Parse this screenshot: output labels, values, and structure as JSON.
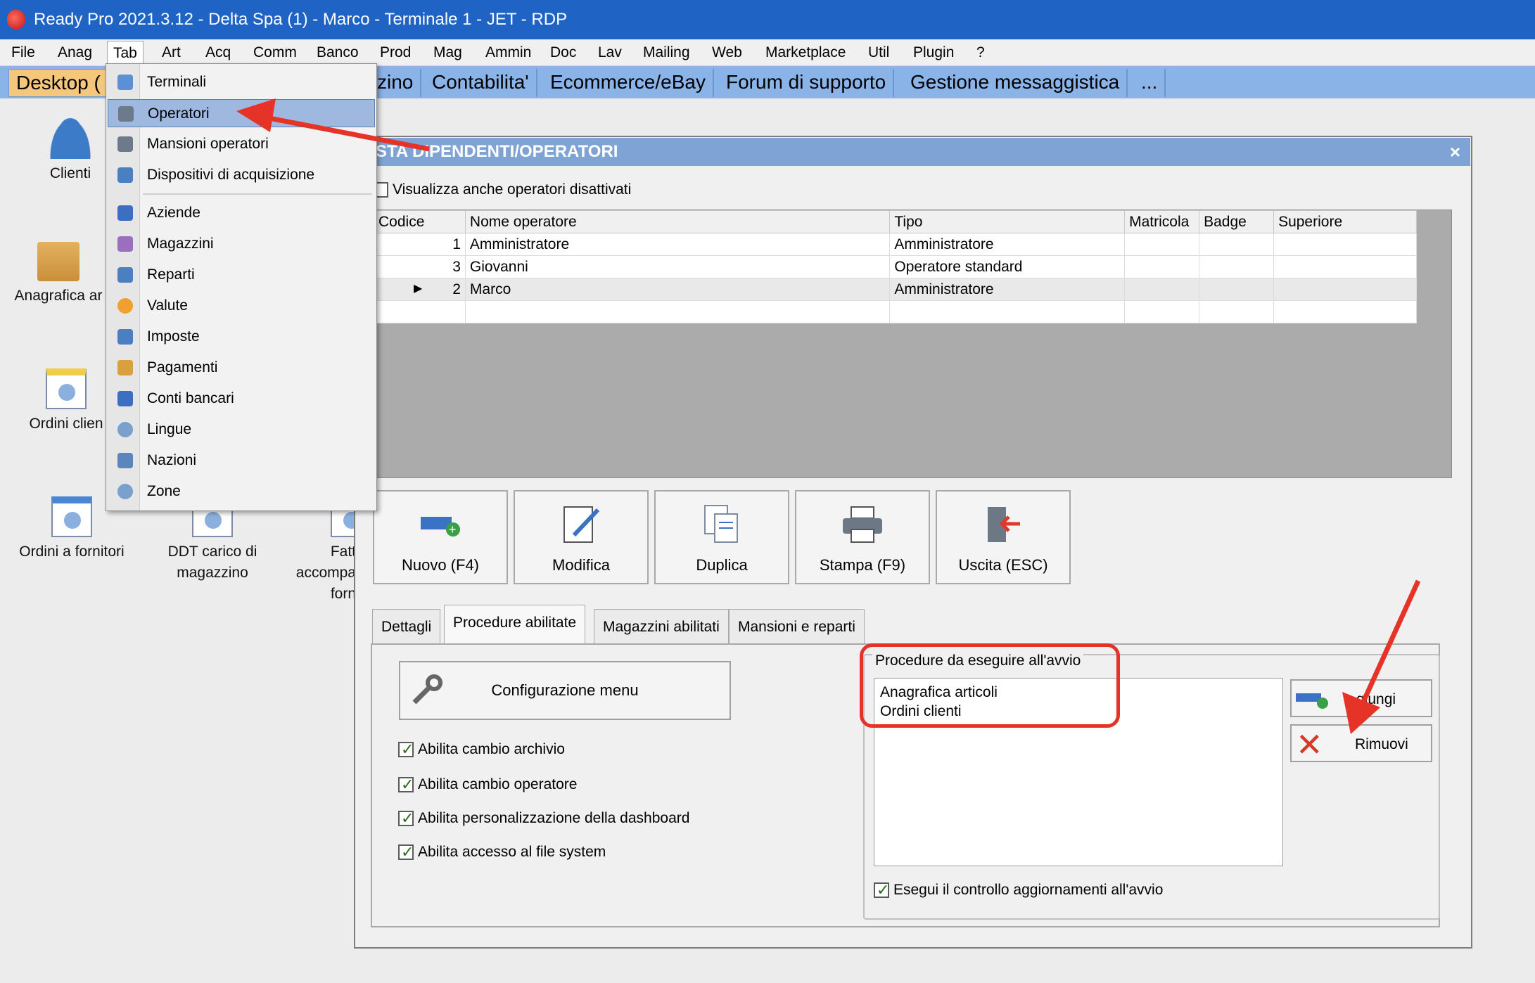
{
  "titlebar": {
    "title": "Ready Pro 2021.3.12 - Delta Spa (1) - Marco - Terminale 1 - JET - RDP"
  },
  "menubar": {
    "items": [
      "File",
      "Anag",
      "Tab",
      "Art",
      "Acq",
      "Comm",
      "Banco",
      "Prod",
      "Mag",
      "Ammin",
      "Doc",
      "Lav",
      "Mailing",
      "Web",
      "Marketplace",
      "Util",
      "Plugin",
      "?"
    ]
  },
  "tabs": {
    "items": [
      "Desktop (",
      "zino",
      "Contabilita'",
      "Ecommerce/eBay",
      "Forum di supporto",
      "Gestione messaggistica",
      "..."
    ]
  },
  "desktop": {
    "icons": [
      {
        "label": "Clienti",
        "icon": "clients-icon"
      },
      {
        "label": "Anagrafica ar",
        "icon": "box-icon"
      },
      {
        "label": "Ordini clien",
        "icon": "orders-icon"
      },
      {
        "label": "Ordini a fornitori",
        "icon": "supplier-orders-icon"
      },
      {
        "label": "DDT carico di",
        "label2": "magazzino",
        "icon": "ddt-icon"
      },
      {
        "label": "Fatt",
        "label2": "accompa",
        "label3": "forn",
        "icon": "invoice-icon"
      }
    ]
  },
  "dropdown": {
    "items": [
      {
        "label": "Terminali",
        "icon": "terminal-icon",
        "color": "#5b8fd6"
      },
      {
        "label": "Operatori",
        "icon": "operator-icon",
        "color": "#6c7a8c",
        "selected": true
      },
      {
        "label": "Mansioni operatori",
        "icon": "roles-icon",
        "color": "#6c7a8c"
      },
      {
        "label": "Dispositivi di acquisizione",
        "icon": "scanner-icon",
        "color": "#4a7fc0"
      },
      {
        "label": "Aziende",
        "icon": "company-icon",
        "color": "#3a6fc2"
      },
      {
        "label": "Magazzini",
        "icon": "warehouse-icon",
        "color": "#9b6fc0"
      },
      {
        "label": "Reparti",
        "icon": "departments-icon",
        "color": "#4a7fc0"
      },
      {
        "label": "Valute",
        "icon": "currency-icon",
        "color": "#f0a030"
      },
      {
        "label": "Imposte",
        "icon": "tax-icon",
        "color": "#4a7fc0"
      },
      {
        "label": "Pagamenti",
        "icon": "payments-icon",
        "color": "#d9a040"
      },
      {
        "label": "Conti bancari",
        "icon": "bank-icon",
        "color": "#3a6fc2"
      },
      {
        "label": "Lingue",
        "icon": "languages-icon",
        "color": "#7aa0cc"
      },
      {
        "label": "Nazioni",
        "icon": "nations-icon",
        "color": "#5a86c0"
      },
      {
        "label": "Zone",
        "icon": "zones-icon",
        "color": "#7aa0cc"
      }
    ]
  },
  "window": {
    "title": "STA DIPENDENTI/OPERATORI",
    "close": "×",
    "show_disabled": "Visualizza anche operatori disattivati",
    "grid": {
      "headers": [
        "Codice",
        "Nome operatore",
        "Tipo",
        "Matricola",
        "Badge",
        "Superiore"
      ],
      "rows": [
        {
          "codice": "1",
          "nome": "Amministratore",
          "tipo": "Amministratore",
          "current": false
        },
        {
          "codice": "3",
          "nome": "Giovanni",
          "tipo": "Operatore standard",
          "current": false
        },
        {
          "codice": "2",
          "nome": "Marco",
          "tipo": "Amministratore",
          "current": true
        }
      ],
      "current_marker": "▶"
    },
    "toolbar": [
      {
        "label": "Nuovo (F4)",
        "icon": "new-icon"
      },
      {
        "label": "Modifica",
        "icon": "edit-icon"
      },
      {
        "label": "Duplica",
        "icon": "duplicate-icon"
      },
      {
        "label": "Stampa (F9)",
        "icon": "print-icon"
      },
      {
        "label": "Uscita (ESC)",
        "icon": "exit-icon"
      }
    ],
    "tabs": [
      "Dettagli",
      "Procedure abilitate",
      "Magazzini abilitati",
      "Mansioni e reparti"
    ],
    "active_tab": "Procedure abilitate",
    "config_menu": "Configurazione menu",
    "checkboxes": [
      {
        "label": "Abilita cambio archivio",
        "checked": true
      },
      {
        "label": "Abilita cambio operatore",
        "checked": true
      },
      {
        "label": "Abilita personalizzazione della dashboard",
        "checked": true
      },
      {
        "label": "Abilita accesso al file system",
        "checked": true
      }
    ],
    "procedures": {
      "legend": "Procedure da eseguire all'avvio",
      "items": [
        "Anagrafica articoli",
        "Ordini clienti"
      ],
      "add": "Aggiungi",
      "add_visible": "giungi",
      "remove": "Rimuovi",
      "check_updates": "Esegui il controllo aggiornamenti all'avvio",
      "check_updates_checked": true
    }
  },
  "annotations": {
    "color": "#e53327"
  }
}
